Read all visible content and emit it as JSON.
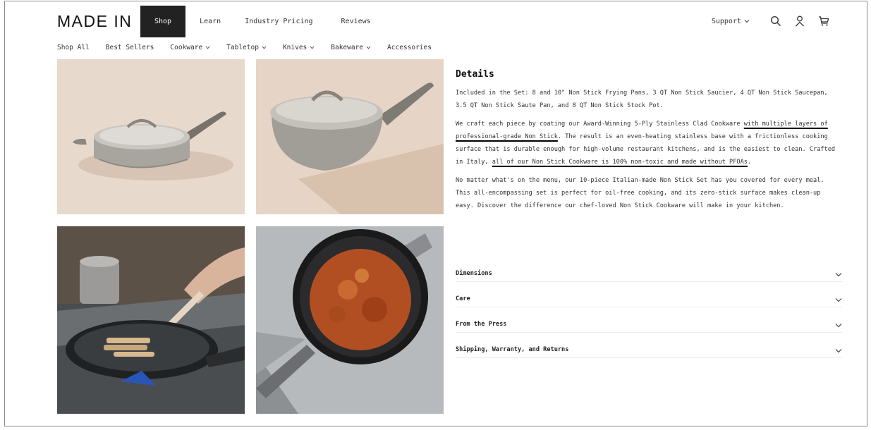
{
  "header": {
    "logo": "MADE IN",
    "nav": [
      {
        "label": "Shop",
        "active": true
      },
      {
        "label": "Learn",
        "active": false
      },
      {
        "label": "Industry Pricing",
        "active": false
      },
      {
        "label": "Reviews",
        "active": false
      }
    ],
    "support_label": "Support",
    "icons": [
      "search-icon",
      "account-icon",
      "cart-icon"
    ]
  },
  "subnav": [
    {
      "label": "Shop All",
      "dropdown": false
    },
    {
      "label": "Best Sellers",
      "dropdown": false
    },
    {
      "label": "Cookware",
      "dropdown": true
    },
    {
      "label": "Tabletop",
      "dropdown": true
    },
    {
      "label": "Knives",
      "dropdown": true
    },
    {
      "label": "Bakeware",
      "dropdown": true
    },
    {
      "label": "Accessories",
      "dropdown": false
    }
  ],
  "details": {
    "title": "Details",
    "p1": "Included in the Set: 8 and 10\" Non Stick Frying Pans, 3 QT Non Stick Saucier, 4 QT Non Stick Saucepan, 3.5 QT Non Stick Saute Pan, and 8 QT Non Stick Stock Pot.",
    "p2_a": "We craft each piece by coating our Award-Winning 5-Ply Stainless Clad Cookware ",
    "p2_u1": "with multiple layers of professional-grade Non Stick",
    "p2_b": ". The result is an even-heating stainless base with a frictionless cooking surface that is durable enough for high-volume restaurant kitchens, and is the easiest to clean. Crafted in Italy, ",
    "p2_u2": "all of our Non Stick Cookware is 100% non-toxic and made without PFOAs",
    "p2_c": ".",
    "p3": "No matter what's on the menu, our 10-piece Italian-made Non Stick Set has you covered for every meal. This all-encompassing set is perfect for oil-free cooking, and its zero-stick surface makes clean-up easy. Discover the difference our chef-loved Non Stick Cookware will make in your kitchen."
  },
  "accordions": [
    {
      "label": "Dimensions"
    },
    {
      "label": "Care"
    },
    {
      "label": "From the Press"
    },
    {
      "label": "Shipping, Warranty, and Returns"
    }
  ],
  "colors": {
    "active_tab": "#222222",
    "text": "#333333",
    "underline": "#000000"
  }
}
